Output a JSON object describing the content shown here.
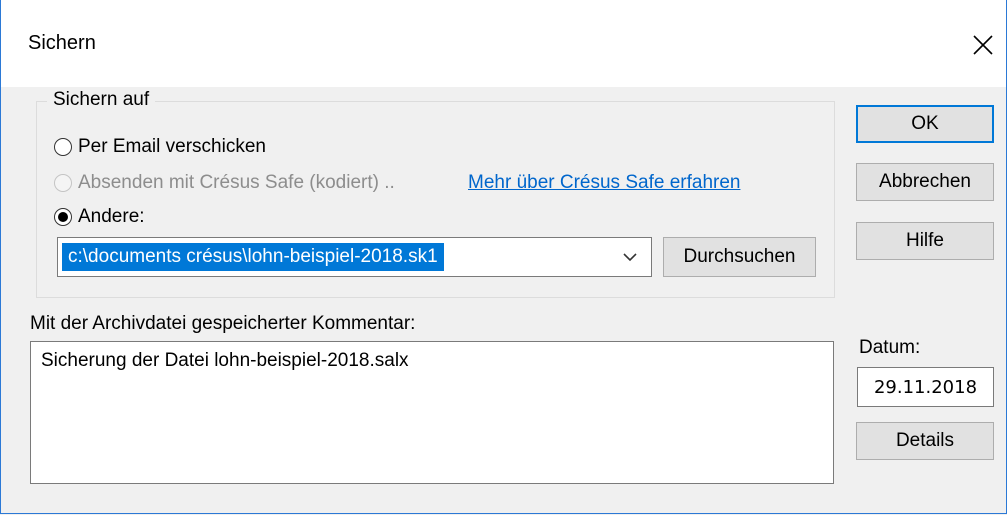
{
  "window": {
    "title": "Sichern"
  },
  "group": {
    "legend": "Sichern auf",
    "options": [
      {
        "label": "Per Email verschicken",
        "checked": false,
        "disabled": false
      },
      {
        "label": "Absenden mit Crésus Safe (kodiert) ..",
        "checked": false,
        "disabled": true
      },
      {
        "label": "Andere:",
        "checked": true,
        "disabled": false
      }
    ],
    "link_text": "Mehr über Crésus Safe erfahren",
    "path_value": "c:\\documents crésus\\lohn-beispiel-2018.sk1",
    "browse_label": "Durchsuchen"
  },
  "buttons": {
    "ok": "OK",
    "cancel": "Abbrechen",
    "help": "Hilfe",
    "details": "Details"
  },
  "comment": {
    "label": "Mit der Archivdatei gespeicherter Kommentar:",
    "value": "Sicherung der Datei lohn-beispiel-2018.salx"
  },
  "date": {
    "label": "Datum:",
    "value": "29.11.2018"
  },
  "colors": {
    "accent": "#0078d7",
    "link": "#0066cc",
    "window_border": "#2b79d6"
  },
  "icons": {
    "close": "close-icon",
    "dropdown": "chevron-down-icon"
  }
}
